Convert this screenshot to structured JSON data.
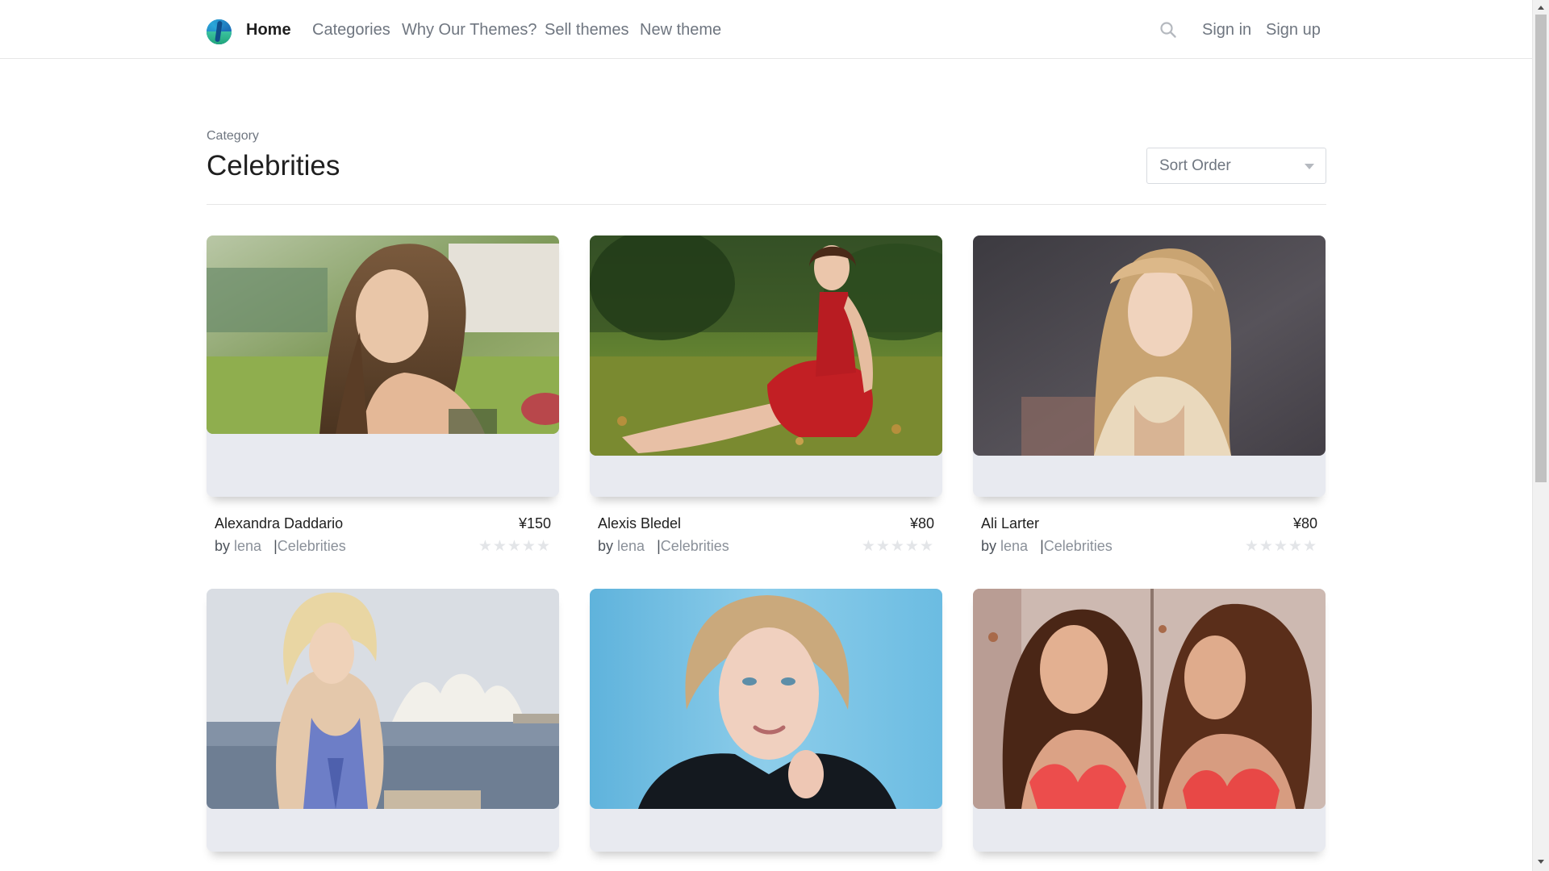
{
  "nav": {
    "logo": "site-logo",
    "home": "Home",
    "categories": "Categories",
    "why": "Why Our Themes?",
    "sell": "Sell themes",
    "new_theme": "New theme",
    "sign_in": "Sign in",
    "sign_up": "Sign up",
    "search_icon": "search-icon"
  },
  "header": {
    "label": "Category",
    "title": "Celebrities",
    "sort": {
      "selected": "Sort Order"
    }
  },
  "colors": {
    "text_primary": "#1f1f1f",
    "text_muted": "#6f7680",
    "card_bg": "#e8eaf0",
    "star_empty": "#e3e5e8"
  },
  "cards": [
    {
      "title": "Alexandra Daddario",
      "price": "¥150",
      "by": "by",
      "author": "lena",
      "sep": "|",
      "category": "Celebrities",
      "stars": "★★★★★",
      "rating": 0
    },
    {
      "title": "Alexis Bledel",
      "price": "¥80",
      "by": "by",
      "author": "lena",
      "sep": "|",
      "category": "Celebrities",
      "stars": "★★★★★",
      "rating": 0
    },
    {
      "title": "Ali Larter",
      "price": "¥80",
      "by": "by",
      "author": "lena",
      "sep": "|",
      "category": "Celebrities",
      "stars": "★★★★★",
      "rating": 0
    },
    {
      "title": "",
      "price": "",
      "by": "",
      "author": "",
      "sep": "",
      "category": "",
      "stars": "",
      "rating": 0
    },
    {
      "title": "",
      "price": "",
      "by": "",
      "author": "",
      "sep": "",
      "category": "",
      "stars": "",
      "rating": 0
    },
    {
      "title": "",
      "price": "",
      "by": "",
      "author": "",
      "sep": "",
      "category": "",
      "stars": "",
      "rating": 0
    }
  ]
}
